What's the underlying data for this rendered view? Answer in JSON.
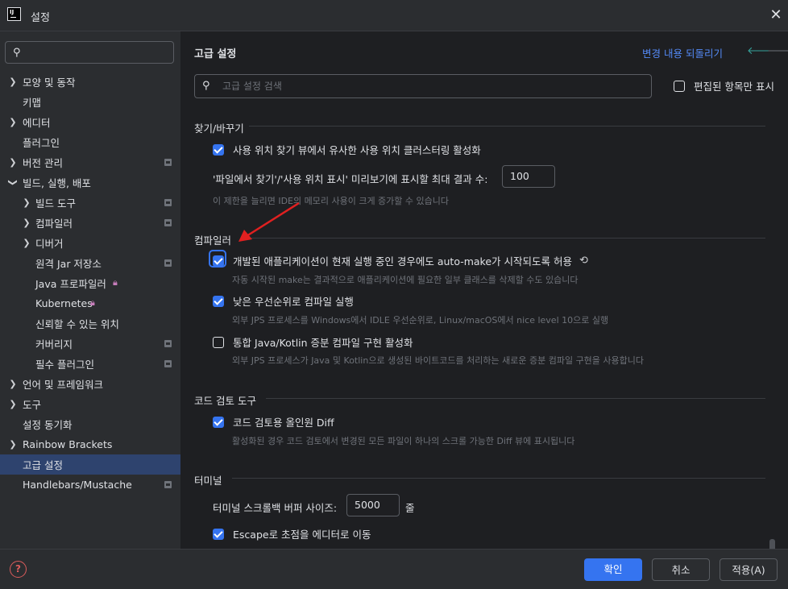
{
  "window": {
    "title": "설정"
  },
  "sidebar": {
    "search_placeholder": "",
    "items": [
      {
        "label": "모양 및 동작",
        "expandable": true,
        "expanded": false
      },
      {
        "label": "키맵"
      },
      {
        "label": "에디터",
        "expandable": true,
        "expanded": false
      },
      {
        "label": "플러그인"
      },
      {
        "label": "버전 관리",
        "expandable": true,
        "expanded": false
      },
      {
        "label": "빌드, 실행, 배포",
        "expandable": true,
        "expanded": true
      },
      {
        "label": "빌드 도구",
        "expandable": true
      },
      {
        "label": "컴파일러",
        "expandable": true
      },
      {
        "label": "디버거",
        "expandable": true
      },
      {
        "label": "원격 Jar 저장소"
      },
      {
        "label": "Java 프로파일러"
      },
      {
        "label": "Kubernetes"
      },
      {
        "label": "신뢰할 수 있는 위치"
      },
      {
        "label": "커버리지"
      },
      {
        "label": "필수 플러그인"
      },
      {
        "label": "언어 및 프레임워크",
        "expandable": true
      },
      {
        "label": "도구",
        "expandable": true
      },
      {
        "label": "설정 동기화"
      },
      {
        "label": "Rainbow Brackets",
        "expandable": true
      },
      {
        "label": "고급 설정",
        "selected": true
      },
      {
        "label": "Handlebars/Mustache"
      }
    ]
  },
  "main": {
    "title": "고급 설정",
    "reset_link": "변경 내용 되돌리기",
    "search_placeholder": "고급 설정 검색",
    "only_modified_label": "편집된 항목만 표시",
    "sections": {
      "find_replace": {
        "title": "찾기/바꾸기",
        "option1": "사용 위치 찾기 뷰에서 유사한 사용 위치 클러스터링 활성화",
        "max_results_label": "'파일에서 찾기'/'사용 위치 표시' 미리보기에 표시할 최대 결과 수:",
        "max_results_value": "100",
        "max_results_hint": "이 제한을 늘리면 IDE의 메모리 사용이 크게 증가할 수 있습니다"
      },
      "compiler": {
        "title": "컴파일러",
        "option1": "개발된 애플리케이션이 현재 실행 중인 경우에도 auto-make가 시작되도록 허용",
        "option1_hint": "자동 시작된 make는 결과적으로 애플리케이션에 필요한 일부 클래스를 삭제할 수도 있습니다",
        "option2": "낮은 우선순위로 컴파일 실행",
        "option2_hint": "외부 JPS 프로세스를 Windows에서 IDLE 우선순위로, Linux/macOS에서 nice level 10으로 실행",
        "option3": "통합 Java/Kotlin 증분 컴파일 구현 활성화",
        "option3_hint": "외부 JPS 프로세스가 Java 및 Kotlin으로 생성된 바이트코드를 처리하는 새로운 증분 컴파일 구현을 사용합니다"
      },
      "code_review": {
        "title": "코드 검토 도구",
        "option1": "코드 검토용 올인원 Diff",
        "option1_hint": "활성화된 경우 코드 검토에서 변경된 모든 파일이 하나의 스크롤 가능한 Diff 뷰에 표시됩니다"
      },
      "terminal": {
        "title": "터미널",
        "buffer_label": "터미널 스크롤백 버퍼 사이즈:",
        "buffer_value": "5000",
        "buffer_unit": "줄",
        "option1": "Escape로 초점을 에디터로 이동"
      }
    }
  },
  "footer": {
    "ok": "확인",
    "cancel": "취소",
    "apply": "적용(A)"
  },
  "colors": {
    "accent": "#3574f0",
    "link": "#548af7",
    "selection": "#2e436e",
    "annotation_arrow": "#e02020"
  }
}
